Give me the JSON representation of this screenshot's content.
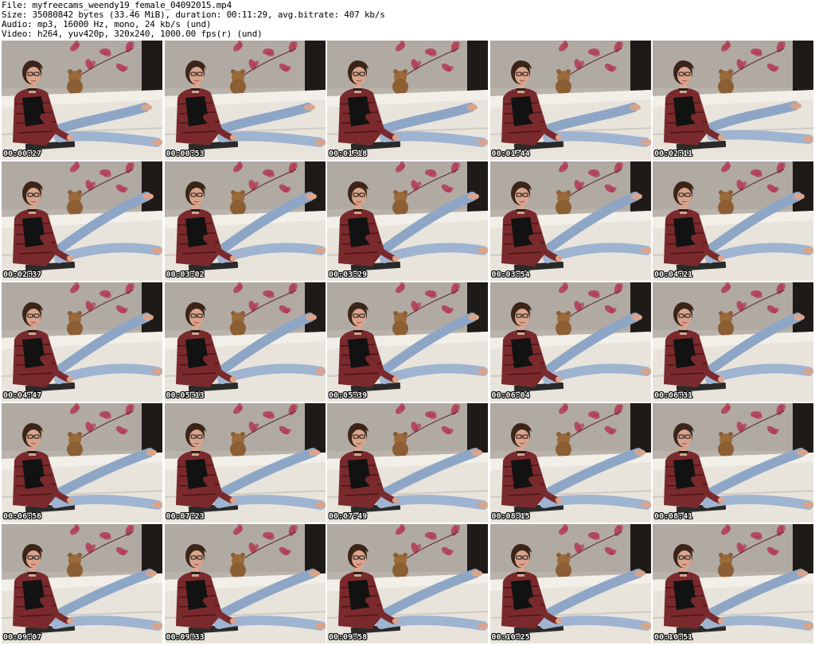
{
  "header": {
    "file_line": "File: myfreecams_weendy19_female_04092015.mp4",
    "size_line": "Size: 35080842 bytes (33.46 MiB), duration: 00:11:29, avg.bitrate: 407 kb/s",
    "audio_line": "Audio: mp3, 16000 Hz, mono, 24 kb/s (und)",
    "video_line": "Video: h264, yuv420p, 320x240, 1000.00 fps(r) (und)"
  },
  "colors": {
    "wall": "#b9b3ab",
    "couch": "#e8e4dc",
    "curtain": "#1e1a18",
    "flower": "#b13a55",
    "jeans": "#8ea6c6",
    "shirt": "#7a2a2c",
    "top": "#121212",
    "hair": "#3b2418",
    "skin": "#d9a48c"
  },
  "thumbnails": [
    {
      "time": "00:00:27",
      "pose": 0
    },
    {
      "time": "00:00:53",
      "pose": 0
    },
    {
      "time": "00:01:18",
      "pose": 0
    },
    {
      "time": "00:01:44",
      "pose": 0
    },
    {
      "time": "00:02:11",
      "pose": 1
    },
    {
      "time": "00:02:37",
      "pose": 2
    },
    {
      "time": "00:03:02",
      "pose": 2
    },
    {
      "time": "00:03:29",
      "pose": 2
    },
    {
      "time": "00:03:54",
      "pose": 2
    },
    {
      "time": "00:04:21",
      "pose": 2
    },
    {
      "time": "00:04:47",
      "pose": 2
    },
    {
      "time": "00:05:13",
      "pose": 2
    },
    {
      "time": "00:05:39",
      "pose": 2
    },
    {
      "time": "00:06:04",
      "pose": 2
    },
    {
      "time": "00:06:31",
      "pose": 2
    },
    {
      "time": "00:06:56",
      "pose": 3
    },
    {
      "time": "00:07:23",
      "pose": 3
    },
    {
      "time": "00:07:49",
      "pose": 3
    },
    {
      "time": "00:08:15",
      "pose": 3
    },
    {
      "time": "00:08:41",
      "pose": 3
    },
    {
      "time": "00:09:07",
      "pose": 3
    },
    {
      "time": "00:09:33",
      "pose": 3
    },
    {
      "time": "00:09:58",
      "pose": 3
    },
    {
      "time": "00:10:25",
      "pose": 3
    },
    {
      "time": "00:10:51",
      "pose": 3
    }
  ]
}
